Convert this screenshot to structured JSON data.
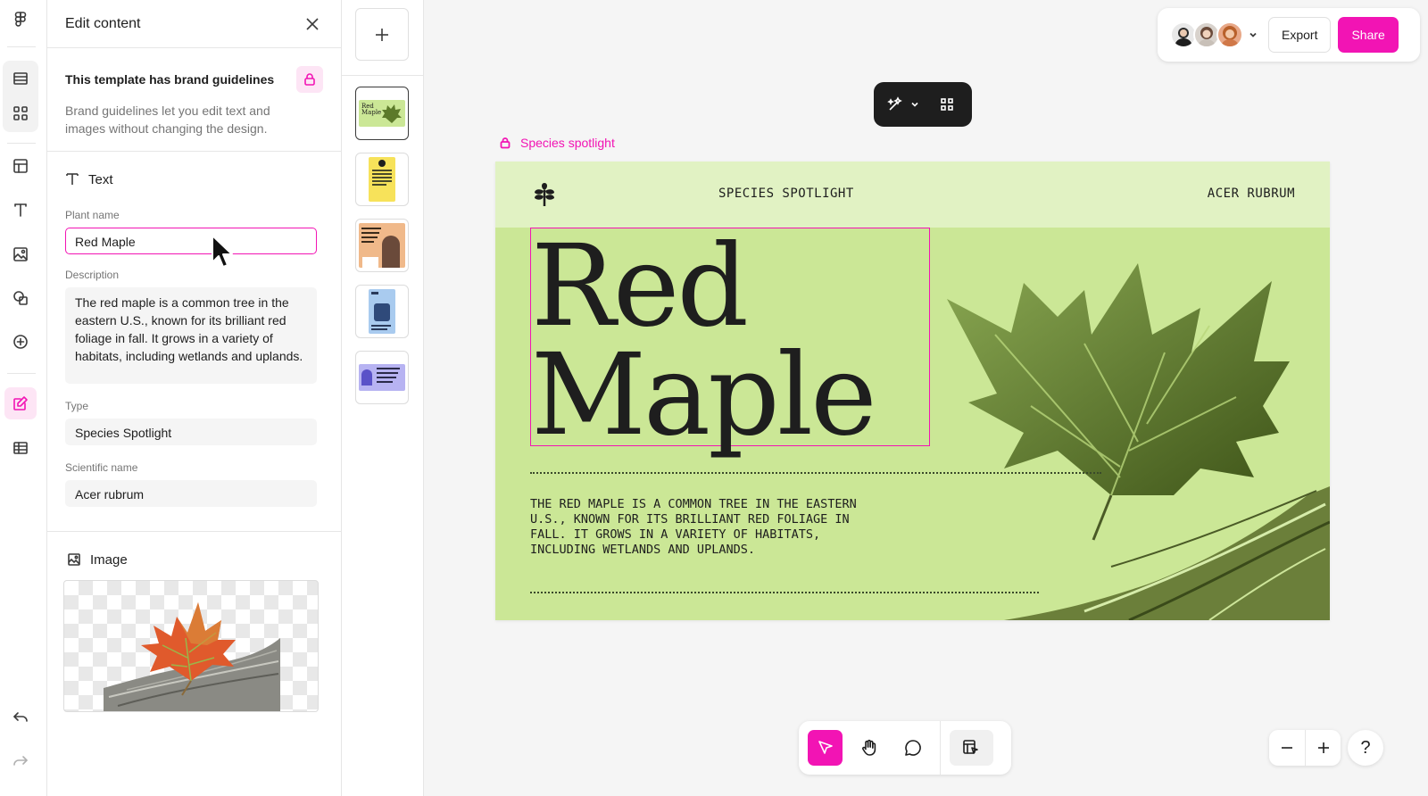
{
  "app": {
    "accent_color": "#f214b4"
  },
  "rail": {
    "icons": [
      "figma-logo-icon",
      "pages-icon",
      "grid-icon",
      "layout-icon",
      "text-icon",
      "image-icon",
      "shapes-icon",
      "plus-circle-icon",
      "edit-content-icon",
      "table-icon",
      "undo-icon",
      "redo-icon"
    ]
  },
  "panel": {
    "title": "Edit content",
    "brand": {
      "title": "This template has brand guidelines",
      "description": "Brand guidelines let you edit text and images without changing the design."
    },
    "text_section": {
      "title": "Text",
      "fields": [
        {
          "label": "Plant name",
          "value": "Red Maple"
        },
        {
          "label": "Description",
          "value": "The red maple is a common tree in the eastern U.S., known for its brilliant red foliage in fall. It grows in a variety of habitats, including wetlands and uplands."
        },
        {
          "label": "Type",
          "value": "Species Spotlight"
        },
        {
          "label": "Scientific name",
          "value": "Acer rubrum"
        }
      ]
    },
    "image_section": {
      "title": "Image"
    }
  },
  "pages": {
    "thumbnails": [
      {
        "label": "Red Maple",
        "color": "#cbe796"
      },
      {
        "label": "Species Spotlight Flower",
        "color": "#f7e25a"
      },
      {
        "label": "Researcher Panel Dr. Anja Fatel",
        "color": "#f0b98a"
      },
      {
        "label": "",
        "color": "#a9cbef"
      },
      {
        "label": "Researcher Panel Patrick Keller",
        "color": "#b7b3f2"
      }
    ]
  },
  "topbar": {
    "export_label": "Export",
    "share_label": "Share"
  },
  "canvas": {
    "frame_label": "Species spotlight",
    "slide": {
      "header_center": "SPECIES SPOTLIGHT",
      "header_right": "ACER RUBRUM",
      "title_line_1": "Red",
      "title_line_2": "Maple",
      "description": "The red maple is a common tree in the eastern U.S., known for its brilliant red foliage in fall. It grows in a variety of habitats, including wetlands and uplands.",
      "bg_color": "#cbe796",
      "header_color": "#e1f2c3"
    }
  },
  "help_label": "?"
}
